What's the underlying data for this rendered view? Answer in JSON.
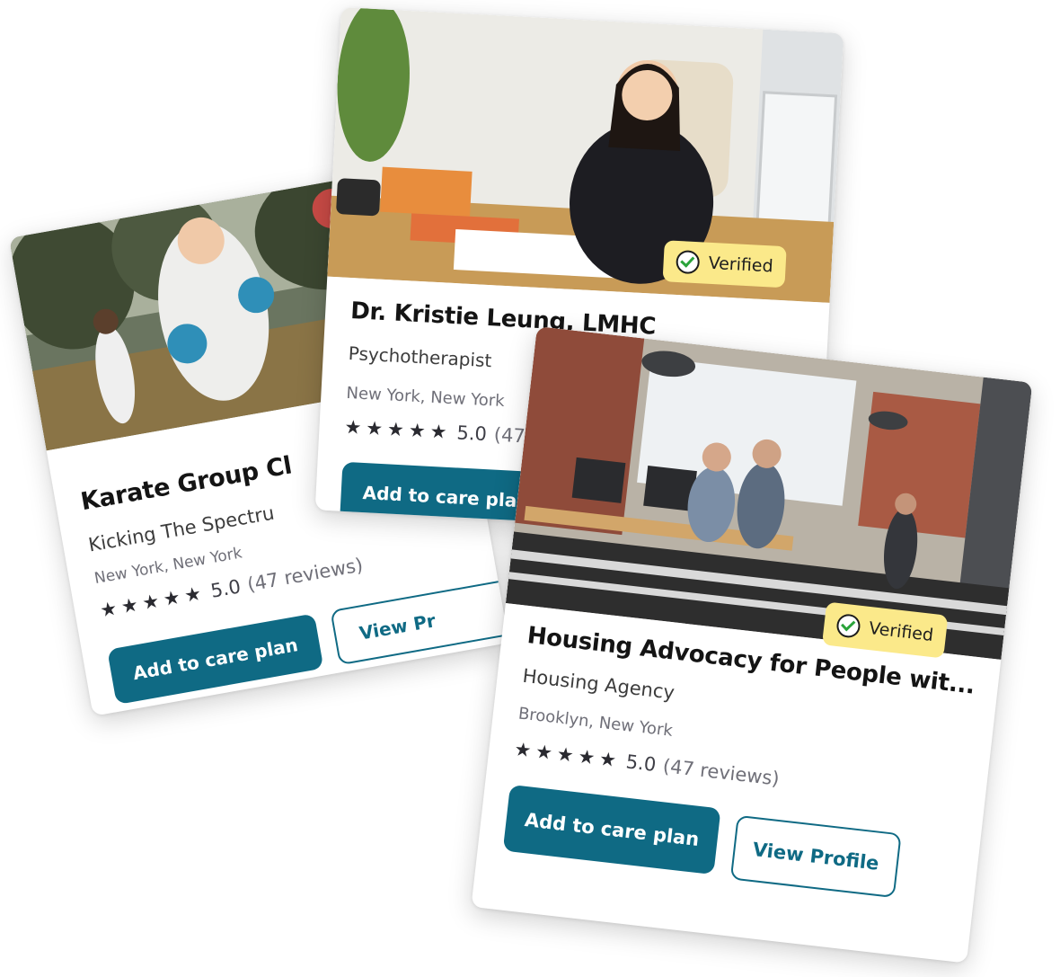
{
  "cards": [
    {
      "title": "Karate Group Cl",
      "subtitle": "Kicking The Spectru",
      "location": "New York, New York",
      "rating": "5.0",
      "reviews": "(47 reviews)",
      "stars": 5,
      "primary_button": "Add to care plan",
      "secondary_button": "View Pr"
    },
    {
      "title": "Dr. Kristie Leung, LMHC",
      "subtitle": "Psychotherapist",
      "location": "New York, New York",
      "rating": "5.0",
      "reviews": "(47",
      "stars": 5,
      "primary_button": "Add to care pla",
      "badge": "Verified"
    },
    {
      "title": "Housing Advocacy for People wit...",
      "subtitle": "Housing Agency",
      "location": "Brooklyn, New York",
      "rating": "5.0",
      "reviews": "(47 reviews)",
      "stars": 5,
      "primary_button": "Add to care plan",
      "secondary_button": "View Profile",
      "badge": "Verified"
    }
  ],
  "colors": {
    "primary": "#0f6a84",
    "badge": "#fbe98a",
    "check": "#2aa33a"
  },
  "icons": [
    "star-icon",
    "check-circle-icon"
  ]
}
